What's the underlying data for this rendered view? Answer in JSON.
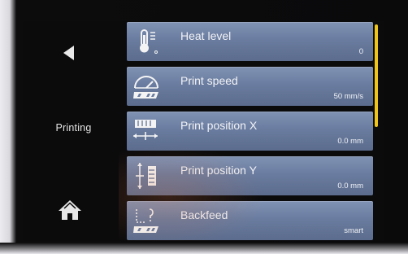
{
  "nav": {
    "back_icon": "back-arrow-icon",
    "status": "Printing",
    "home_icon": "home-icon"
  },
  "settings": [
    {
      "label": "Heat level",
      "value": "0",
      "icon": "thermometer-icon"
    },
    {
      "label": "Print speed",
      "value": "50 mm/s",
      "icon": "speedometer-icon"
    },
    {
      "label": "Print position X",
      "value": "0.0 mm",
      "icon": "position-x-icon"
    },
    {
      "label": "Print position Y",
      "value": "0.0 mm",
      "icon": "position-y-icon"
    },
    {
      "label": "Backfeed",
      "value": "smart",
      "icon": "backfeed-icon"
    }
  ],
  "colors": {
    "accent": "#f0c51b",
    "row": "#6a7c9f",
    "screen": "#0b0b0c",
    "text": "#f2f3f6"
  },
  "scroll_position": 0.0
}
